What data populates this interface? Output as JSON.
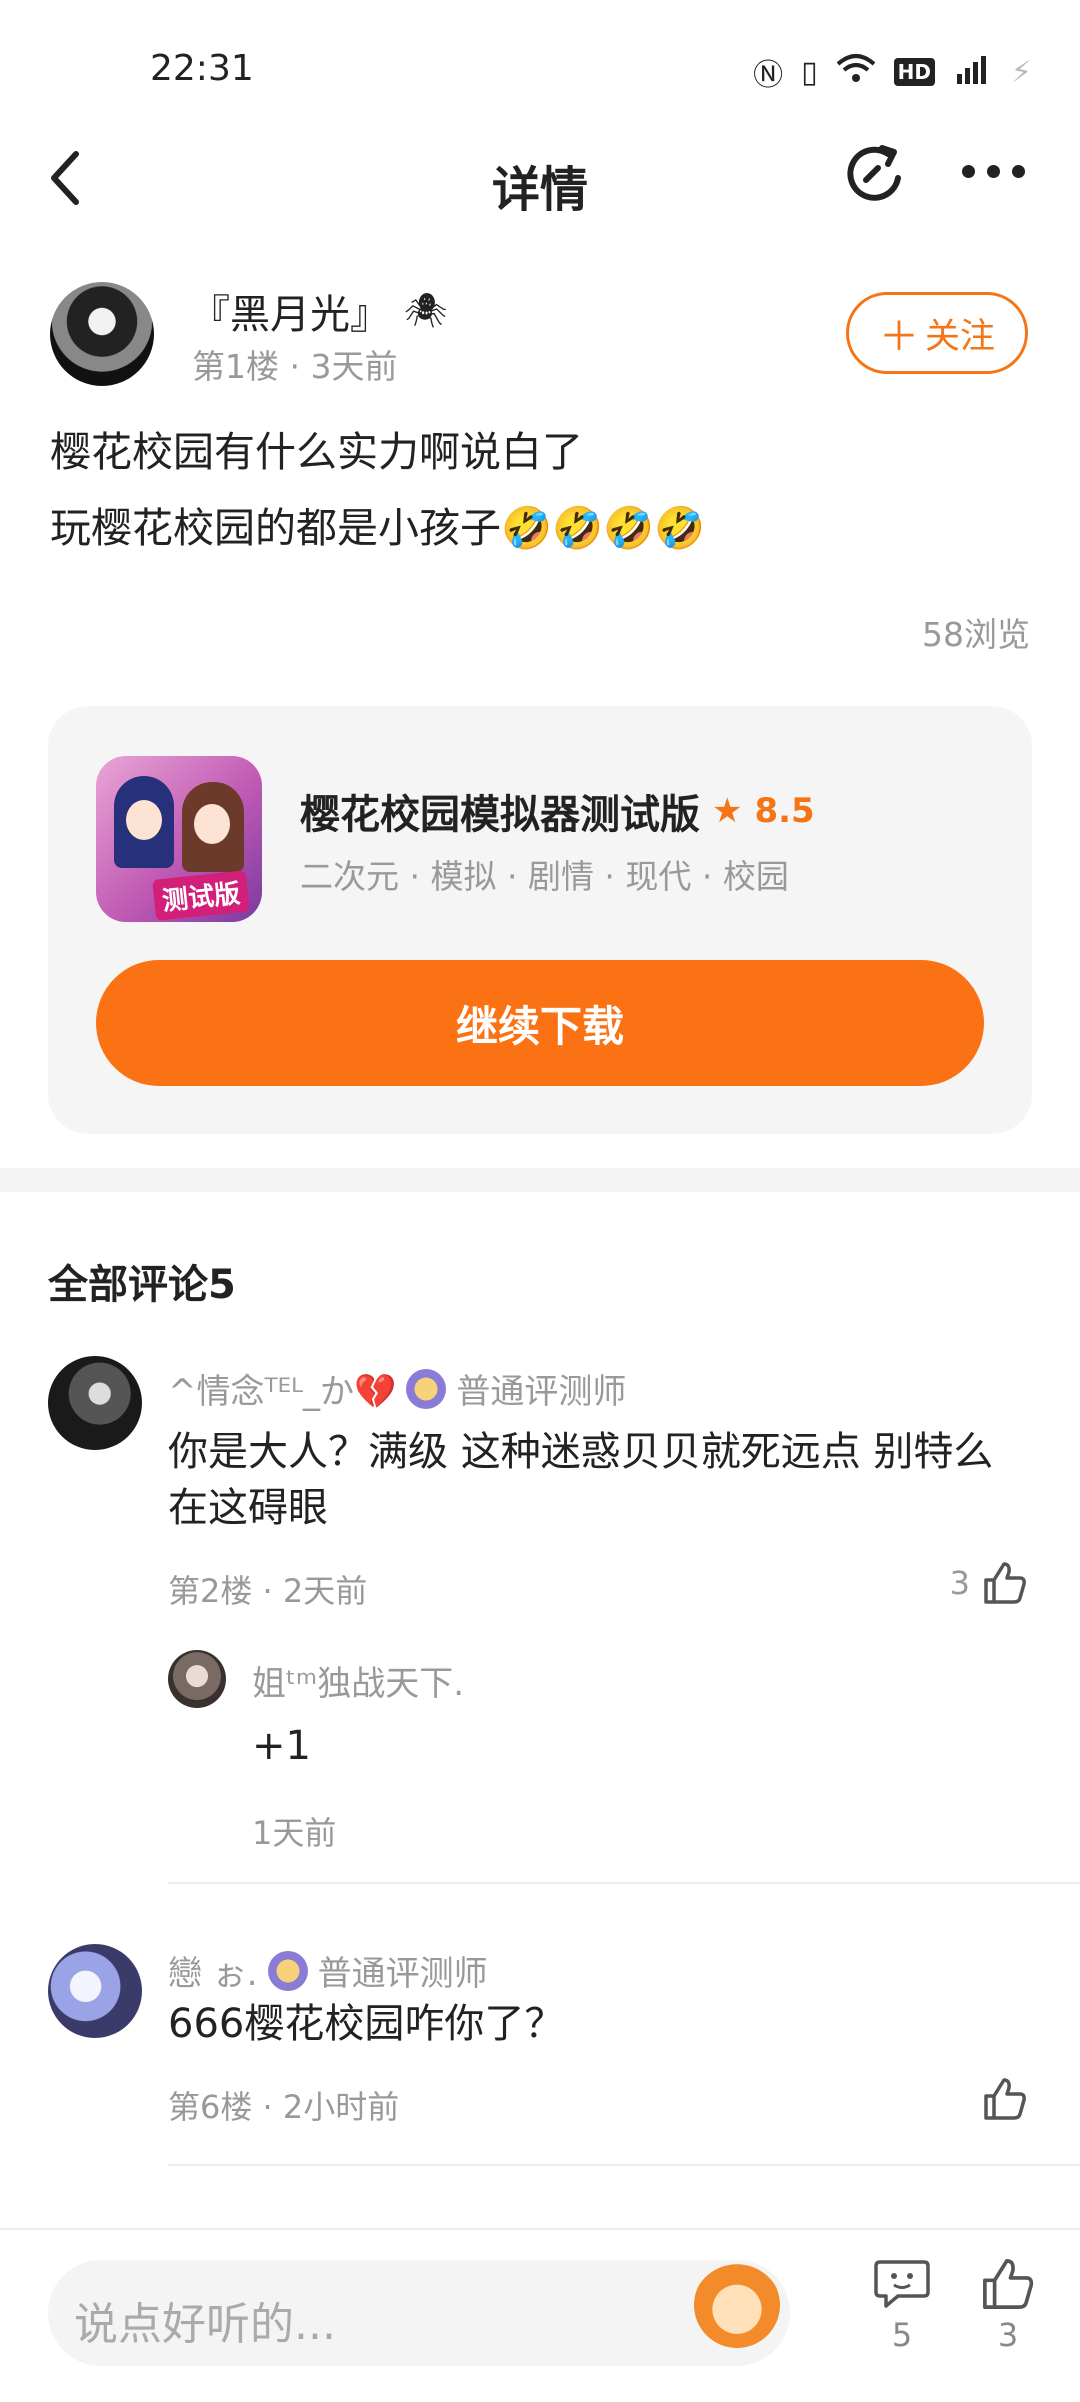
{
  "status_bar": {
    "time": "22:31",
    "icons": [
      "nfc-icon",
      "vibrate-icon",
      "wifi-icon",
      "hd-icon",
      "signal-5g-icon",
      "battery-charging-icon"
    ]
  },
  "nav": {
    "title": "详情"
  },
  "post": {
    "author": "『黑月光』",
    "author_icon": "spider-icon",
    "floor": "第1楼",
    "time": "3天前",
    "follow_label": "关注",
    "lines": [
      "樱花校园有什么实力啊说白了",
      "玩樱花校园的都是小孩子🤣🤣🤣🤣"
    ],
    "views": "58浏览"
  },
  "game": {
    "title": "樱花校园模拟器测试版",
    "rating": "8.5",
    "tags": "二次元 · 模拟 · 剧情 · 现代 · 校园",
    "icon_badge": "测试版",
    "download_label": "继续下载"
  },
  "comments_header": "全部评论5",
  "comments": [
    {
      "user": "^情念ᵀᴱᴸ_か💔",
      "badge": "普通评测师",
      "text": "你是大人？满级 这种迷惑贝贝就死远点 别特么在这碍眼",
      "floor": "第2楼",
      "time": "2天前",
      "likes": "3",
      "reply": {
        "user": "姐ᵗᵐ独战天下.",
        "text": "+1",
        "time": "1天前"
      }
    },
    {
      "user": "戀 ぉ.",
      "badge": "普通评测师",
      "text": "666樱花校园咋你了？",
      "floor": "第6楼",
      "time": "2小时前",
      "likes": ""
    }
  ],
  "bottom": {
    "placeholder": "说点好听的...",
    "comment_count": "5",
    "like_count": "3"
  },
  "colors": {
    "accent": "#f57516",
    "button": "#fb7215"
  }
}
